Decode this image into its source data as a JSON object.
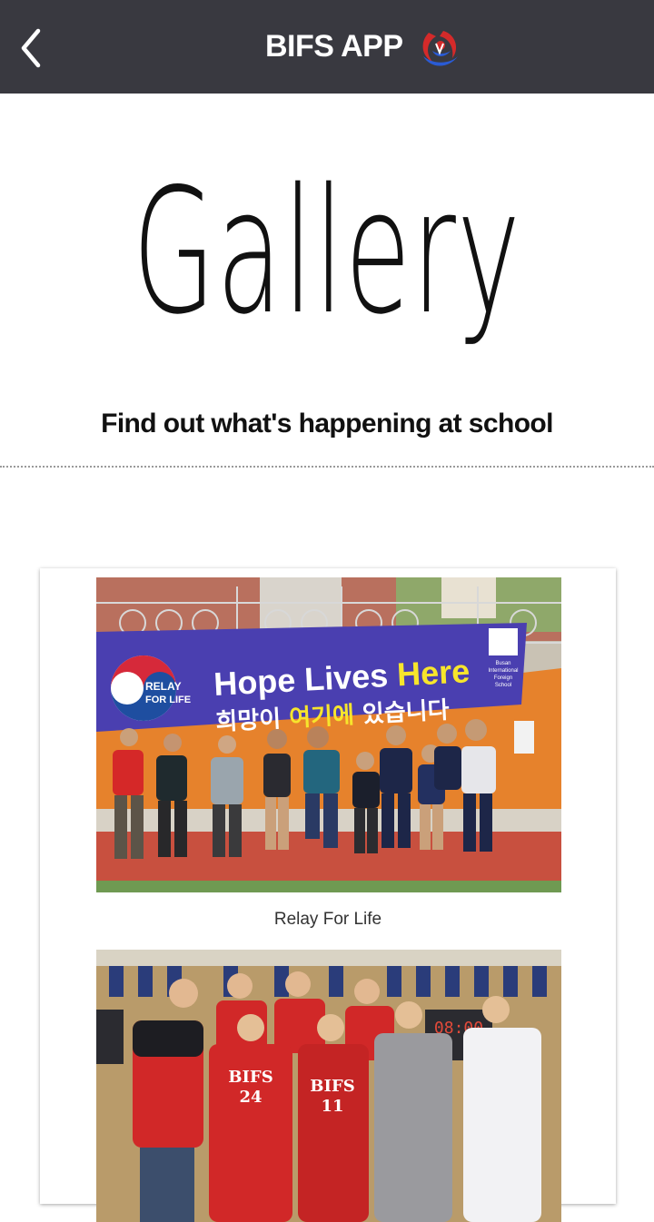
{
  "header": {
    "title": "BIFS APP",
    "back_icon": "chevron-left-icon",
    "logo_icon": "bifs-logo-icon",
    "background": "#393940"
  },
  "page": {
    "title": "Gallery",
    "subtitle": "Find out what's happening at school"
  },
  "gallery": {
    "items": [
      {
        "caption": "Relay For Life",
        "banner_main": "Hope Lives ",
        "banner_here": "Here",
        "banner_korean_1": "희망이 ",
        "banner_korean_2": "여기에",
        "banner_korean_3": " 있습니다",
        "banner_logo_1": "RELAY",
        "banner_logo_2": "FOR LIFE",
        "banner_school_1": "Busan",
        "banner_school_2": "International",
        "banner_school_3": "Foreign",
        "banner_school_4": "School"
      },
      {
        "caption": "",
        "jersey_text": "BIFS",
        "jersey_num_1": "24",
        "jersey_num_2": "11",
        "scoreboard": "08:00"
      }
    ]
  }
}
